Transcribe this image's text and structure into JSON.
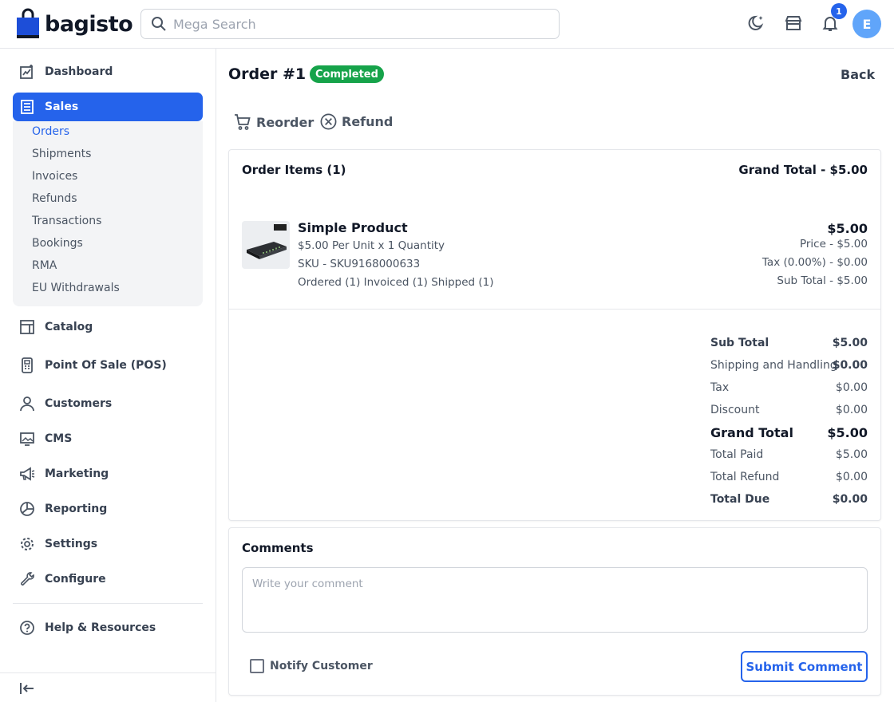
{
  "header": {
    "brand": "bagisto",
    "search_placeholder": "Mega Search",
    "notification_count": "1",
    "avatar_initial": "E"
  },
  "sidebar": {
    "items": [
      {
        "label": "Dashboard",
        "icon": "dashboard-icon"
      },
      {
        "label": "Sales",
        "icon": "sales-icon",
        "active": true
      },
      {
        "label": "Catalog",
        "icon": "catalog-icon"
      },
      {
        "label": "Point Of Sale (POS)",
        "icon": "pos-icon"
      },
      {
        "label": "Customers",
        "icon": "customers-icon"
      },
      {
        "label": "CMS",
        "icon": "cms-icon"
      },
      {
        "label": "Marketing",
        "icon": "marketing-icon"
      },
      {
        "label": "Reporting",
        "icon": "reporting-icon"
      },
      {
        "label": "Settings",
        "icon": "settings-icon"
      },
      {
        "label": "Configure",
        "icon": "configure-icon"
      }
    ],
    "sales_submenu": [
      "Orders",
      "Shipments",
      "Invoices",
      "Refunds",
      "Transactions",
      "Bookings",
      "RMA",
      "EU Withdrawals"
    ],
    "help_label": "Help & Resources"
  },
  "order": {
    "title": "Order #1",
    "status": "Completed",
    "back_label": "Back",
    "reorder_label": "Reorder",
    "refund_label": "Refund"
  },
  "items_card": {
    "heading": "Order Items (1)",
    "grand_total_heading": "Grand Total - $5.00",
    "product": {
      "name": "Simple Product",
      "unit_line": "$5.00 Per Unit x 1 Quantity",
      "sku_line": "SKU - SKU9168000633",
      "status_line": "Ordered (1) Invoiced (1) Shipped (1)",
      "amount": "$5.00",
      "price_line": "Price - $5.00",
      "tax_line": "Tax (0.00%) - $0.00",
      "subtotal_line": "Sub Total - $5.00"
    }
  },
  "summary": [
    {
      "label": "Sub Total",
      "value": "$5.00"
    },
    {
      "label": "Shipping and Handling",
      "value": "$0.00"
    },
    {
      "label": "Tax",
      "value": "$0.00"
    },
    {
      "label": "Discount",
      "value": "$0.00"
    },
    {
      "label": "Grand Total",
      "value": "$5.00"
    },
    {
      "label": "Total Paid",
      "value": "$5.00"
    },
    {
      "label": "Total Refund",
      "value": "$0.00"
    },
    {
      "label": "Total Due",
      "value": "$0.00"
    }
  ],
  "comments": {
    "heading": "Comments",
    "placeholder": "Write your comment",
    "notify_label": "Notify Customer",
    "submit_label": "Submit Comment"
  },
  "colors": {
    "primary": "#2563eb",
    "success": "#16a34a",
    "submenu_bg": "#f3f4f6"
  }
}
